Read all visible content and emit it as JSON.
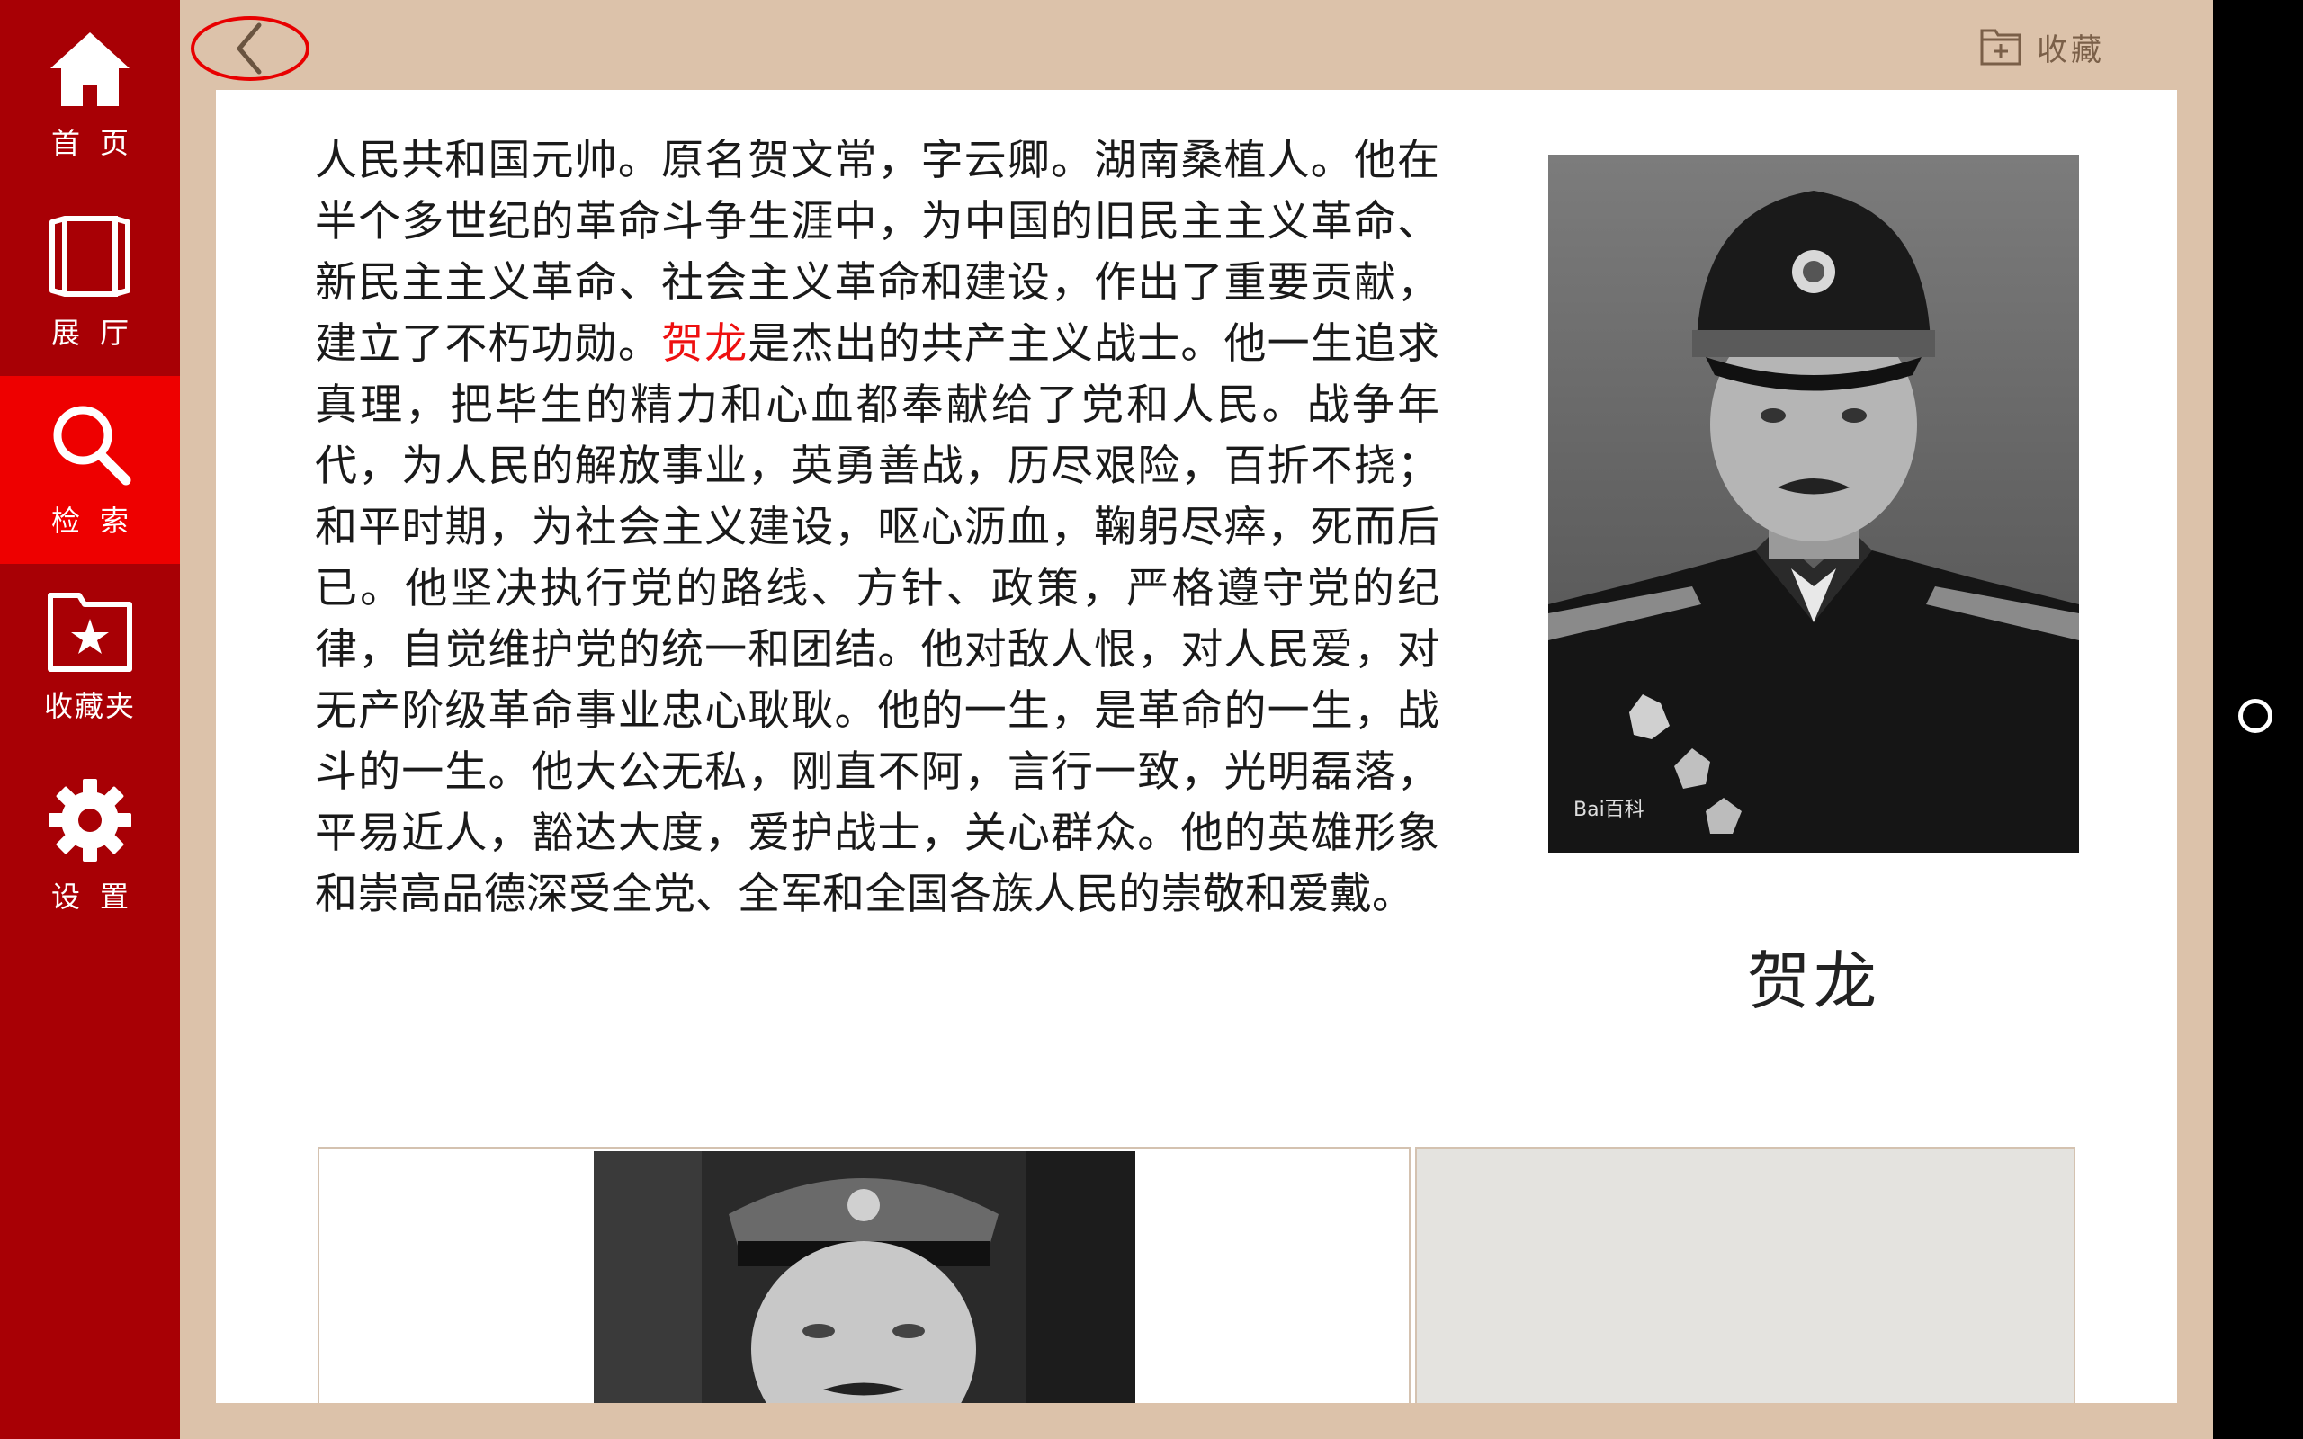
{
  "sidebar": {
    "items": [
      {
        "label": "首页",
        "icon": "home-icon"
      },
      {
        "label": "展厅",
        "icon": "book-icon"
      },
      {
        "label": "检索",
        "icon": "search-icon",
        "active": true
      },
      {
        "label": "收藏夹",
        "icon": "favorites-folder-icon"
      },
      {
        "label": "设置",
        "icon": "gear-icon"
      }
    ]
  },
  "header": {
    "back_icon": "chevron-left-icon",
    "favorite_label": "收藏",
    "favorite_icon": "add-folder-icon"
  },
  "article": {
    "text_before": "人民共和国元帅。原名贺文常，字云卿。湖南桑植人。他在半个多世纪的革命斗争生涯中，为中国的旧民主主义革命、新民主主义革命、社会主义革命和建设，作出了重要贡献，建立了不朽功勋。",
    "highlight": "贺龙",
    "text_after": "是杰出的共产主义战士。他一生追求真理，把毕生的精力和心血都奉献给了党和人民。战争年代，为人民的解放事业，英勇善战，历尽艰险，百折不挠；和平时期，为社会主义建设，呕心沥血，鞠躬尽瘁，死而后已。他坚决执行党的路线、方针、政策，严格遵守党的纪律，自觉维护党的统一和团结。他对敌人恨，对人民爱，对无产阶级革命事业忠心耿耿。他的一生，是革命的一生，战斗的一生。他大公无私，刚直不阿，言行一致，光明磊落，平易近人，豁达大度，爱护战士，关心群众。他的英雄形象和崇高品德深受全党、全军和全国各族人民的崇敬和爱戴。"
  },
  "portrait": {
    "name": "贺龙",
    "watermark": "Bai百科"
  },
  "colors": {
    "sidebar": "#a80005",
    "sidebar_active": "#ee0000",
    "background": "#dcc2aa",
    "highlight": "#ee1010"
  }
}
